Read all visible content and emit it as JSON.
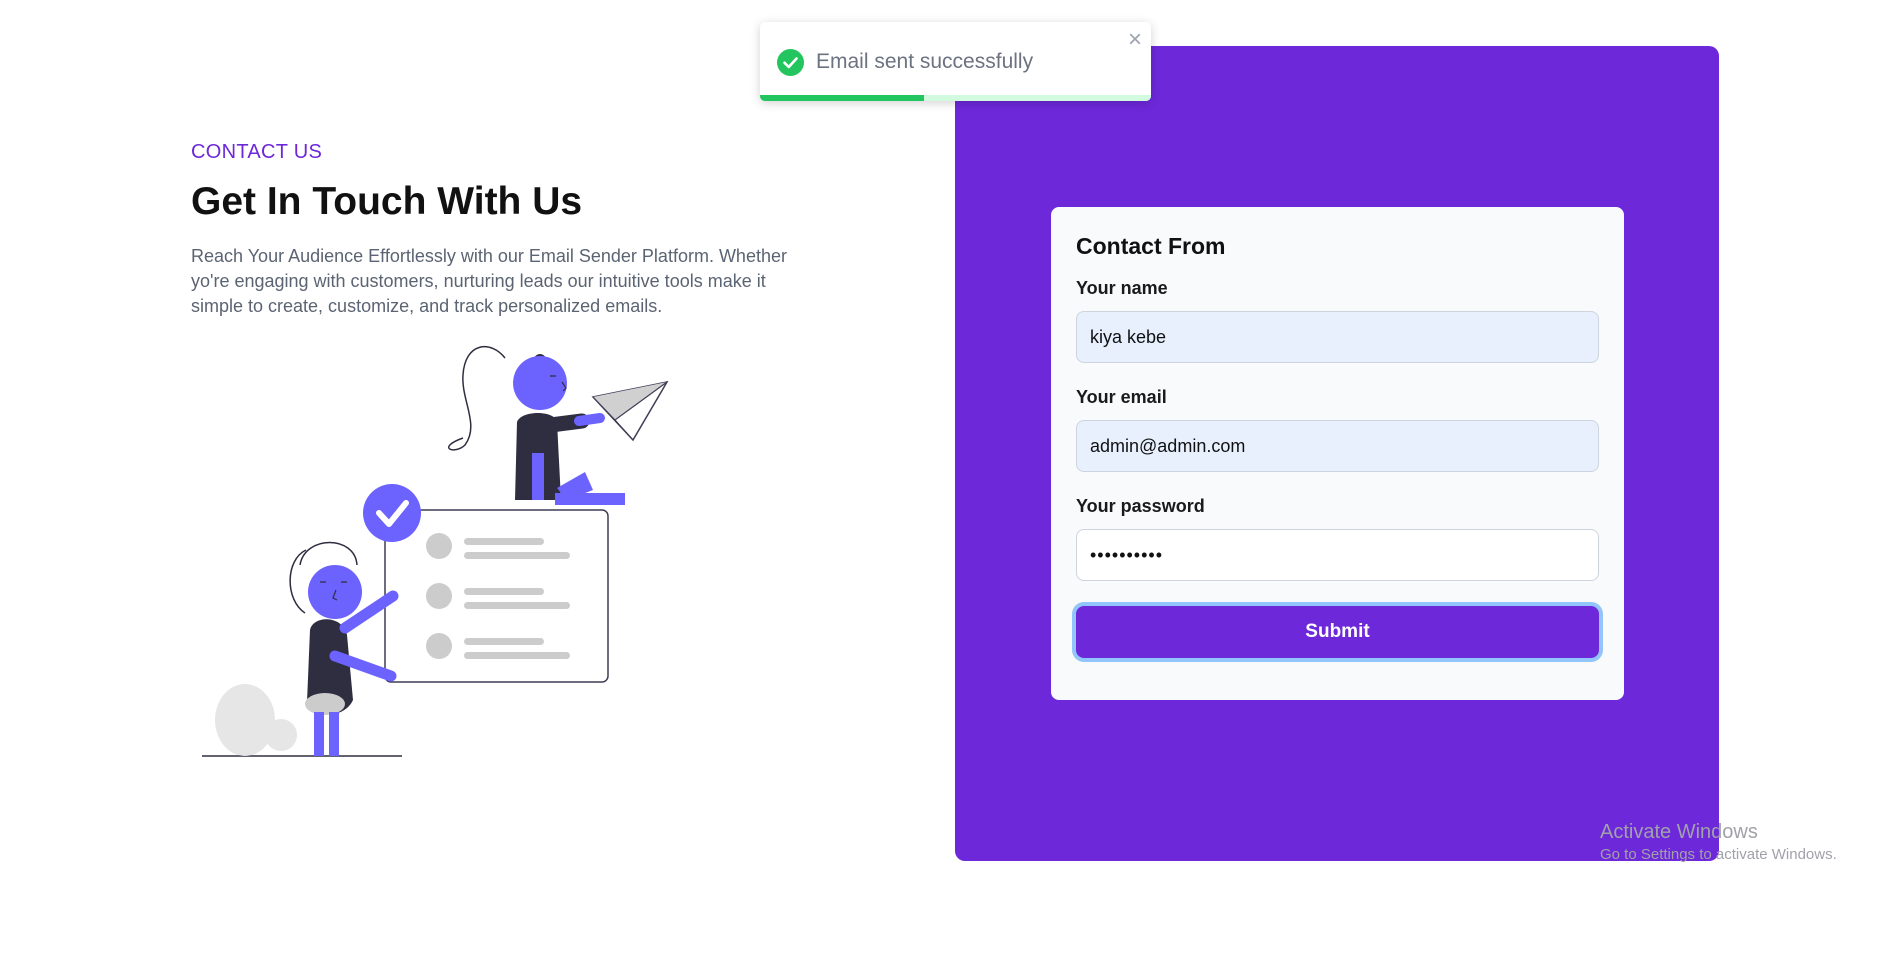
{
  "toast": {
    "message": "Email sent successfully",
    "close_symbol": "×",
    "icon": "check-circle-icon",
    "progress": 0.42,
    "success_color": "#22c55e"
  },
  "contact": {
    "eyebrow": "CONTACT US",
    "headline": "Get In Touch With Us",
    "description": "Reach Your Audience Effortlessly with our Email Sender Platform. Whether yo're engaging with customers, nurturing leads our intuitive tools make it simple to create, customize, and track personalized emails."
  },
  "form": {
    "title": "Contact From",
    "name_label": "Your name",
    "name_value": "kiya kebe",
    "email_label": "Your email",
    "email_value": "admin@admin.com",
    "password_label": "Your password",
    "password_value": "••••••••••",
    "submit_label": "Submit"
  },
  "watermark": {
    "title": "Activate Windows",
    "subtitle": "Go to Settings to activate Windows."
  },
  "colors": {
    "accent": "#6d28d9",
    "illustration": "#6c63ff",
    "dark": "#2f2e41"
  }
}
